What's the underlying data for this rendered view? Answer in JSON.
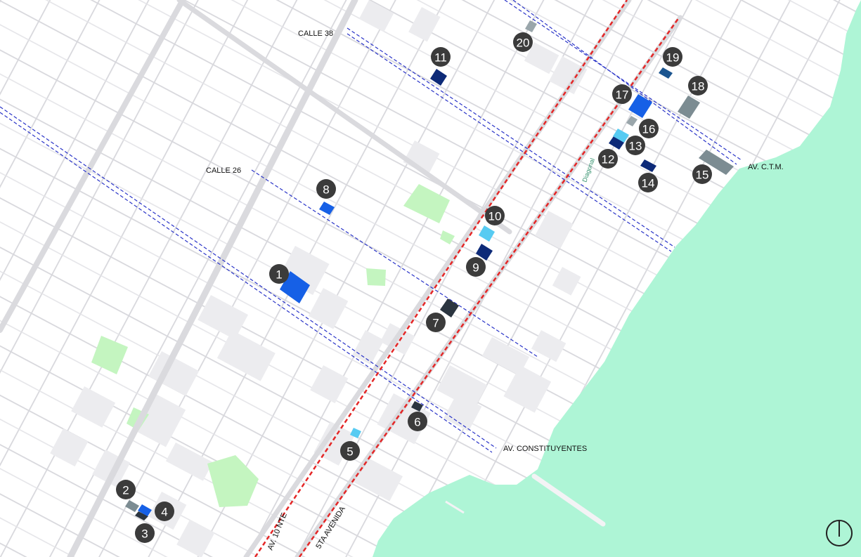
{
  "colors": {
    "background": "#ffffff",
    "water": "#aef5d6",
    "street": "#d7d7dc",
    "block": "#f1f1f3",
    "park": "#c4f5c0",
    "main_avenue": "#e42727",
    "cycle_route": "#2a34c8",
    "marker": "#3b3b3b",
    "marker_text": "#ffffff"
  },
  "streets": {
    "calle_38": "CALLE 38",
    "calle_26": "CALLE 26",
    "av_ctm": "AV.  C.T.M.",
    "av_constituyentes": "AV. CONSTITUYENTES",
    "av_10_nte": "AV. 10 NTE",
    "quinta_avenida": "5TA AVENIDA",
    "diagonal": "Diagonal"
  },
  "compass_icon": "north-arrow-icon",
  "markers": [
    {
      "id": "1",
      "color": "#1660e6"
    },
    {
      "id": "2",
      "color": "#7c8c92"
    },
    {
      "id": "3",
      "color": "#2b3540"
    },
    {
      "id": "4",
      "color": "#1660e6"
    },
    {
      "id": "5",
      "color": "#57cbf2"
    },
    {
      "id": "6",
      "color": "#2b3540"
    },
    {
      "id": "7",
      "color": "#2b3540"
    },
    {
      "id": "8",
      "color": "#1660e6"
    },
    {
      "id": "9",
      "color": "#0d2a78"
    },
    {
      "id": "10",
      "color": "#57cbf2"
    },
    {
      "id": "11",
      "color": "#0d2a78"
    },
    {
      "id": "12",
      "color": "#0d2a78"
    },
    {
      "id": "13",
      "color": "#57cbf2"
    },
    {
      "id": "14",
      "color": "#0d2a78"
    },
    {
      "id": "15",
      "color": "#7c8c92"
    },
    {
      "id": "16",
      "color": "#9aa6ab"
    },
    {
      "id": "17",
      "color": "#1660e6"
    },
    {
      "id": "18",
      "color": "#7c8c92"
    },
    {
      "id": "19",
      "color": "#1b5590"
    },
    {
      "id": "20",
      "color": "#9aa6ab"
    }
  ]
}
